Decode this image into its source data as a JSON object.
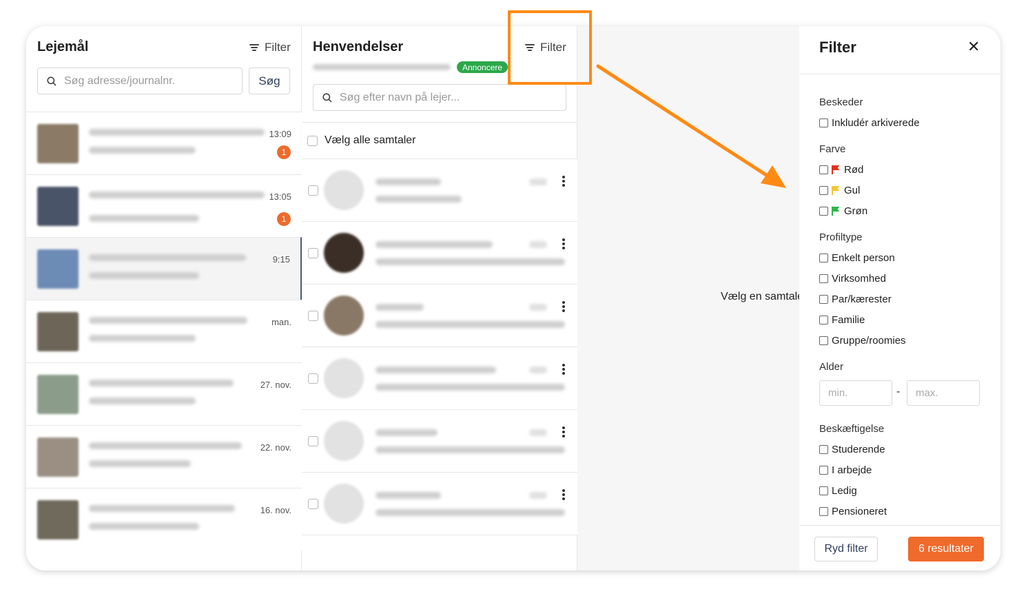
{
  "lejemaal": {
    "title": "Lejemål",
    "filter_label": "Filter",
    "search_placeholder": "Søg adresse/journalnr.",
    "search_button": "Søg",
    "items": [
      {
        "time": "13:09",
        "badge": "1",
        "thumb_color": "#8a7a66"
      },
      {
        "time": "13:05",
        "badge": "1",
        "thumb_color": "#4a5468"
      },
      {
        "time": "9:15",
        "badge": "",
        "thumb_color": "#6c8bb5"
      },
      {
        "time": "man.",
        "badge": "",
        "thumb_color": "#6d6658"
      },
      {
        "time": "27. nov.",
        "badge": "",
        "thumb_color": "#8b9c8a"
      },
      {
        "time": "22. nov.",
        "badge": "",
        "thumb_color": "#9a8f82"
      },
      {
        "time": "16. nov.",
        "badge": "",
        "thumb_color": "#6f6a5c"
      }
    ]
  },
  "henvendelser": {
    "title": "Henvendelser",
    "filter_label": "Filter",
    "status_badge": "Annoncere",
    "search_placeholder": "Søg efter navn på lejer...",
    "select_all_label": "Vælg alle samtaler",
    "conversations": [
      {
        "avatar_color": "#e2e2e2"
      },
      {
        "avatar_color": "#3a2e26"
      },
      {
        "avatar_color": "#8a7866"
      },
      {
        "avatar_color": "#e2e2e2"
      },
      {
        "avatar_color": "#e2e2e2"
      },
      {
        "avatar_color": "#e2e2e2"
      }
    ]
  },
  "detail": {
    "empty_text": "Vælg en samtale"
  },
  "filter_panel": {
    "title": "Filter",
    "close_icon": "close-icon",
    "sections": {
      "beskeder": {
        "label": "Beskeder",
        "options": [
          "Inkludér arkiverede"
        ]
      },
      "farve": {
        "label": "Farve",
        "options": [
          {
            "label": "Rød",
            "color": "#e0321f"
          },
          {
            "label": "Gul",
            "color": "#f7c531"
          },
          {
            "label": "Grøn",
            "color": "#2cb54a"
          }
        ]
      },
      "profiltype": {
        "label": "Profiltype",
        "options": [
          "Enkelt person",
          "Virksomhed",
          "Par/kærester",
          "Familie",
          "Gruppe/roomies"
        ]
      },
      "alder": {
        "label": "Alder",
        "min_placeholder": "min.",
        "max_placeholder": "max.",
        "separator": "-"
      },
      "beskaeftigelse": {
        "label": "Beskæftigelse",
        "options": [
          "Studerende",
          "I arbejde",
          "Ledig",
          "Pensioneret"
        ]
      }
    },
    "clear_button": "Ryd filter",
    "results_button": "6 resultater"
  },
  "annotation": {
    "color": "#ff8a13"
  }
}
